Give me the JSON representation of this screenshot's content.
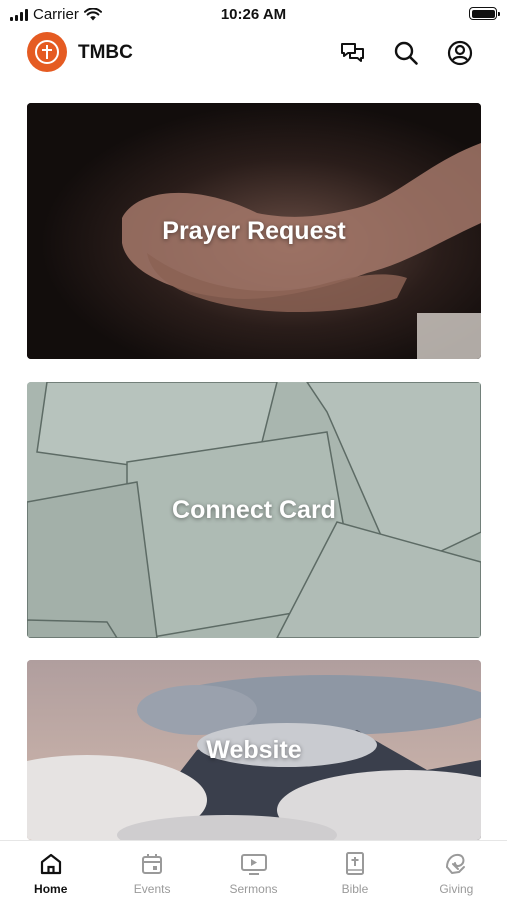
{
  "status_bar": {
    "carrier": "Carrier",
    "time": "10:26 AM"
  },
  "header": {
    "app_title": "TMBC",
    "logo_color": "#e55b22",
    "icons": [
      "chat-bubbles-icon",
      "search-icon",
      "account-icon"
    ]
  },
  "cards": [
    {
      "label": "Prayer Request"
    },
    {
      "label": "Connect Card"
    },
    {
      "label": "Website"
    }
  ],
  "tab_bar": {
    "active_tab": "Home",
    "tabs": [
      {
        "label": "Home",
        "icon": "home-icon"
      },
      {
        "label": "Events",
        "icon": "calendar-icon"
      },
      {
        "label": "Sermons",
        "icon": "video-icon"
      },
      {
        "label": "Bible",
        "icon": "bible-icon"
      },
      {
        "label": "Giving",
        "icon": "giving-icon"
      }
    ],
    "active_color": "#111111",
    "inactive_color": "#9a9a9a"
  }
}
